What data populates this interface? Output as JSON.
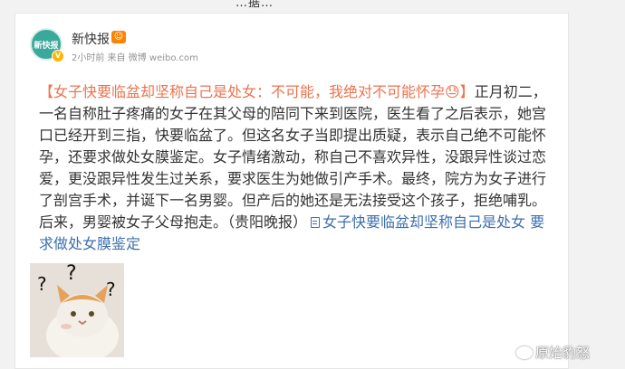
{
  "top_clip_text": "…据…",
  "post": {
    "avatar_text": "新快报",
    "username": "新快报",
    "meta": "2小时前 来自 微博 weibo.com",
    "segments": {
      "hashtag": "【女子快要临盆却坚称自己是处女：不可能，我绝对不可能怀孕😓】",
      "body": "正月初二，一名自称肚子疼痛的女子在其父母的陪同下来到医院，医生看了之后表示，她宫口已经开到三指，快要临盆了。但这名女子当即提出质疑，表示自己绝不可能怀孕，还要求做处女膜鉴定。女子情绪激动，称自己不喜欢异性，没跟异性谈过恋爱，更没跟异性发生过关系，要求医生为她做引产手术。最终，院方为女子进行了剖宫手术，并诞下一名男婴。但产后的她还是无法接受这个孩子，拒绝哺乳。后来，男婴被女子父母抱走。（贵阳晚报）",
      "link": "女子快要临盆却坚称自己是处女 要求做处女膜鉴定"
    },
    "watermark": "原始豹怒"
  },
  "colors": {
    "link": "#3c6fae",
    "accent": "#eb7350",
    "verified": "#ffb400"
  }
}
